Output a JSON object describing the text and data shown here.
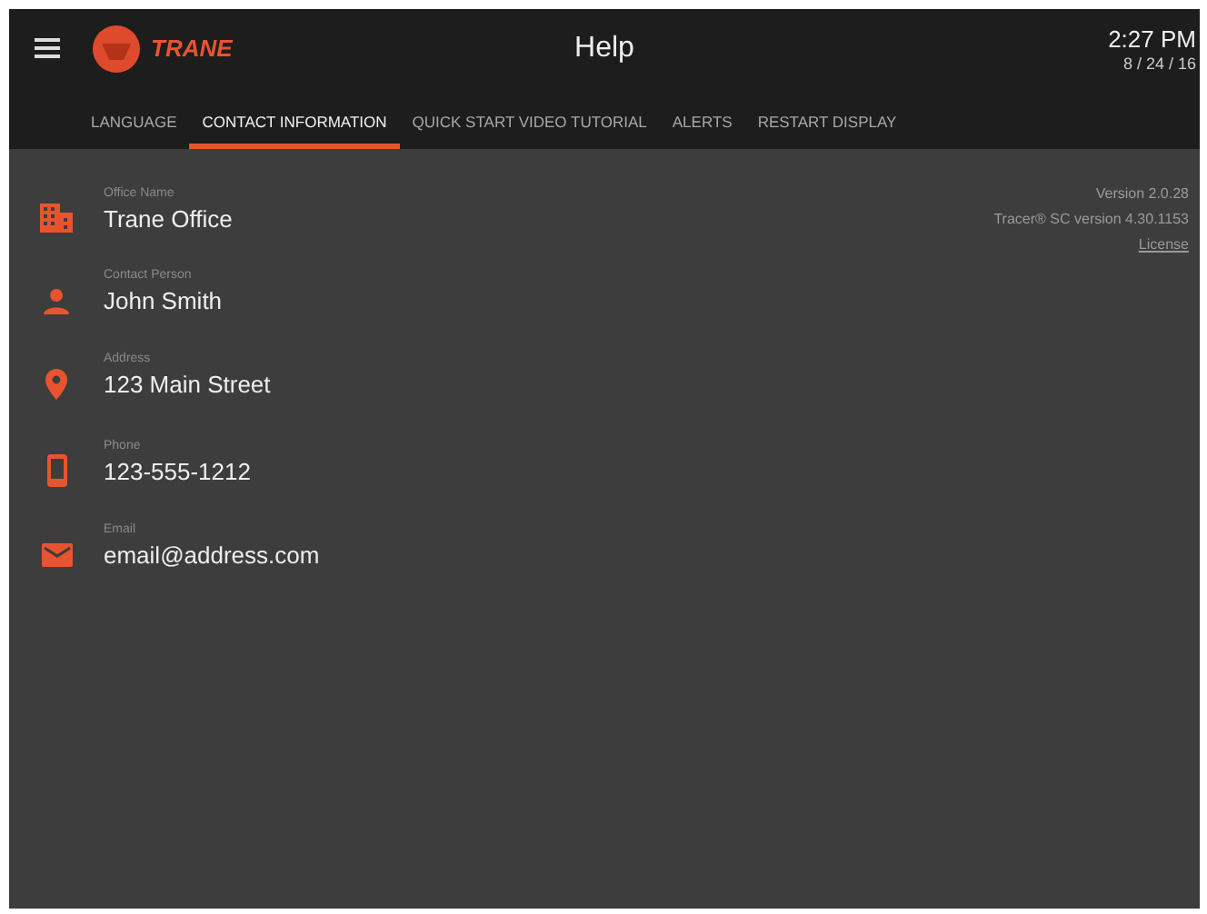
{
  "header": {
    "logo_text": "TRANE",
    "title": "Help",
    "time": "2:27 PM",
    "date": "8 / 24 / 16"
  },
  "tabs": [
    {
      "label": "LANGUAGE",
      "selected": false
    },
    {
      "label": "CONTACT INFORMATION",
      "selected": true
    },
    {
      "label": "QUICK START VIDEO TUTORIAL",
      "selected": false
    },
    {
      "label": "ALERTS",
      "selected": false
    },
    {
      "label": "RESTART DISPLAY",
      "selected": false
    }
  ],
  "contacts": [
    {
      "kind": "building",
      "label": "Office Name",
      "value": "Trane Office"
    },
    {
      "kind": "person",
      "label": "Contact Person",
      "value": "John Smith"
    },
    {
      "kind": "location",
      "label": "Address",
      "value": "123 Main Street"
    },
    {
      "kind": "phone",
      "label": "Phone",
      "value": "123-555-1212"
    },
    {
      "kind": "email",
      "label": "Email",
      "value": "email@address.com"
    }
  ],
  "about": {
    "version": "Version 2.0.28",
    "tracer_version": "Tracer® SC version 4.30.1153",
    "license_link": "License"
  }
}
